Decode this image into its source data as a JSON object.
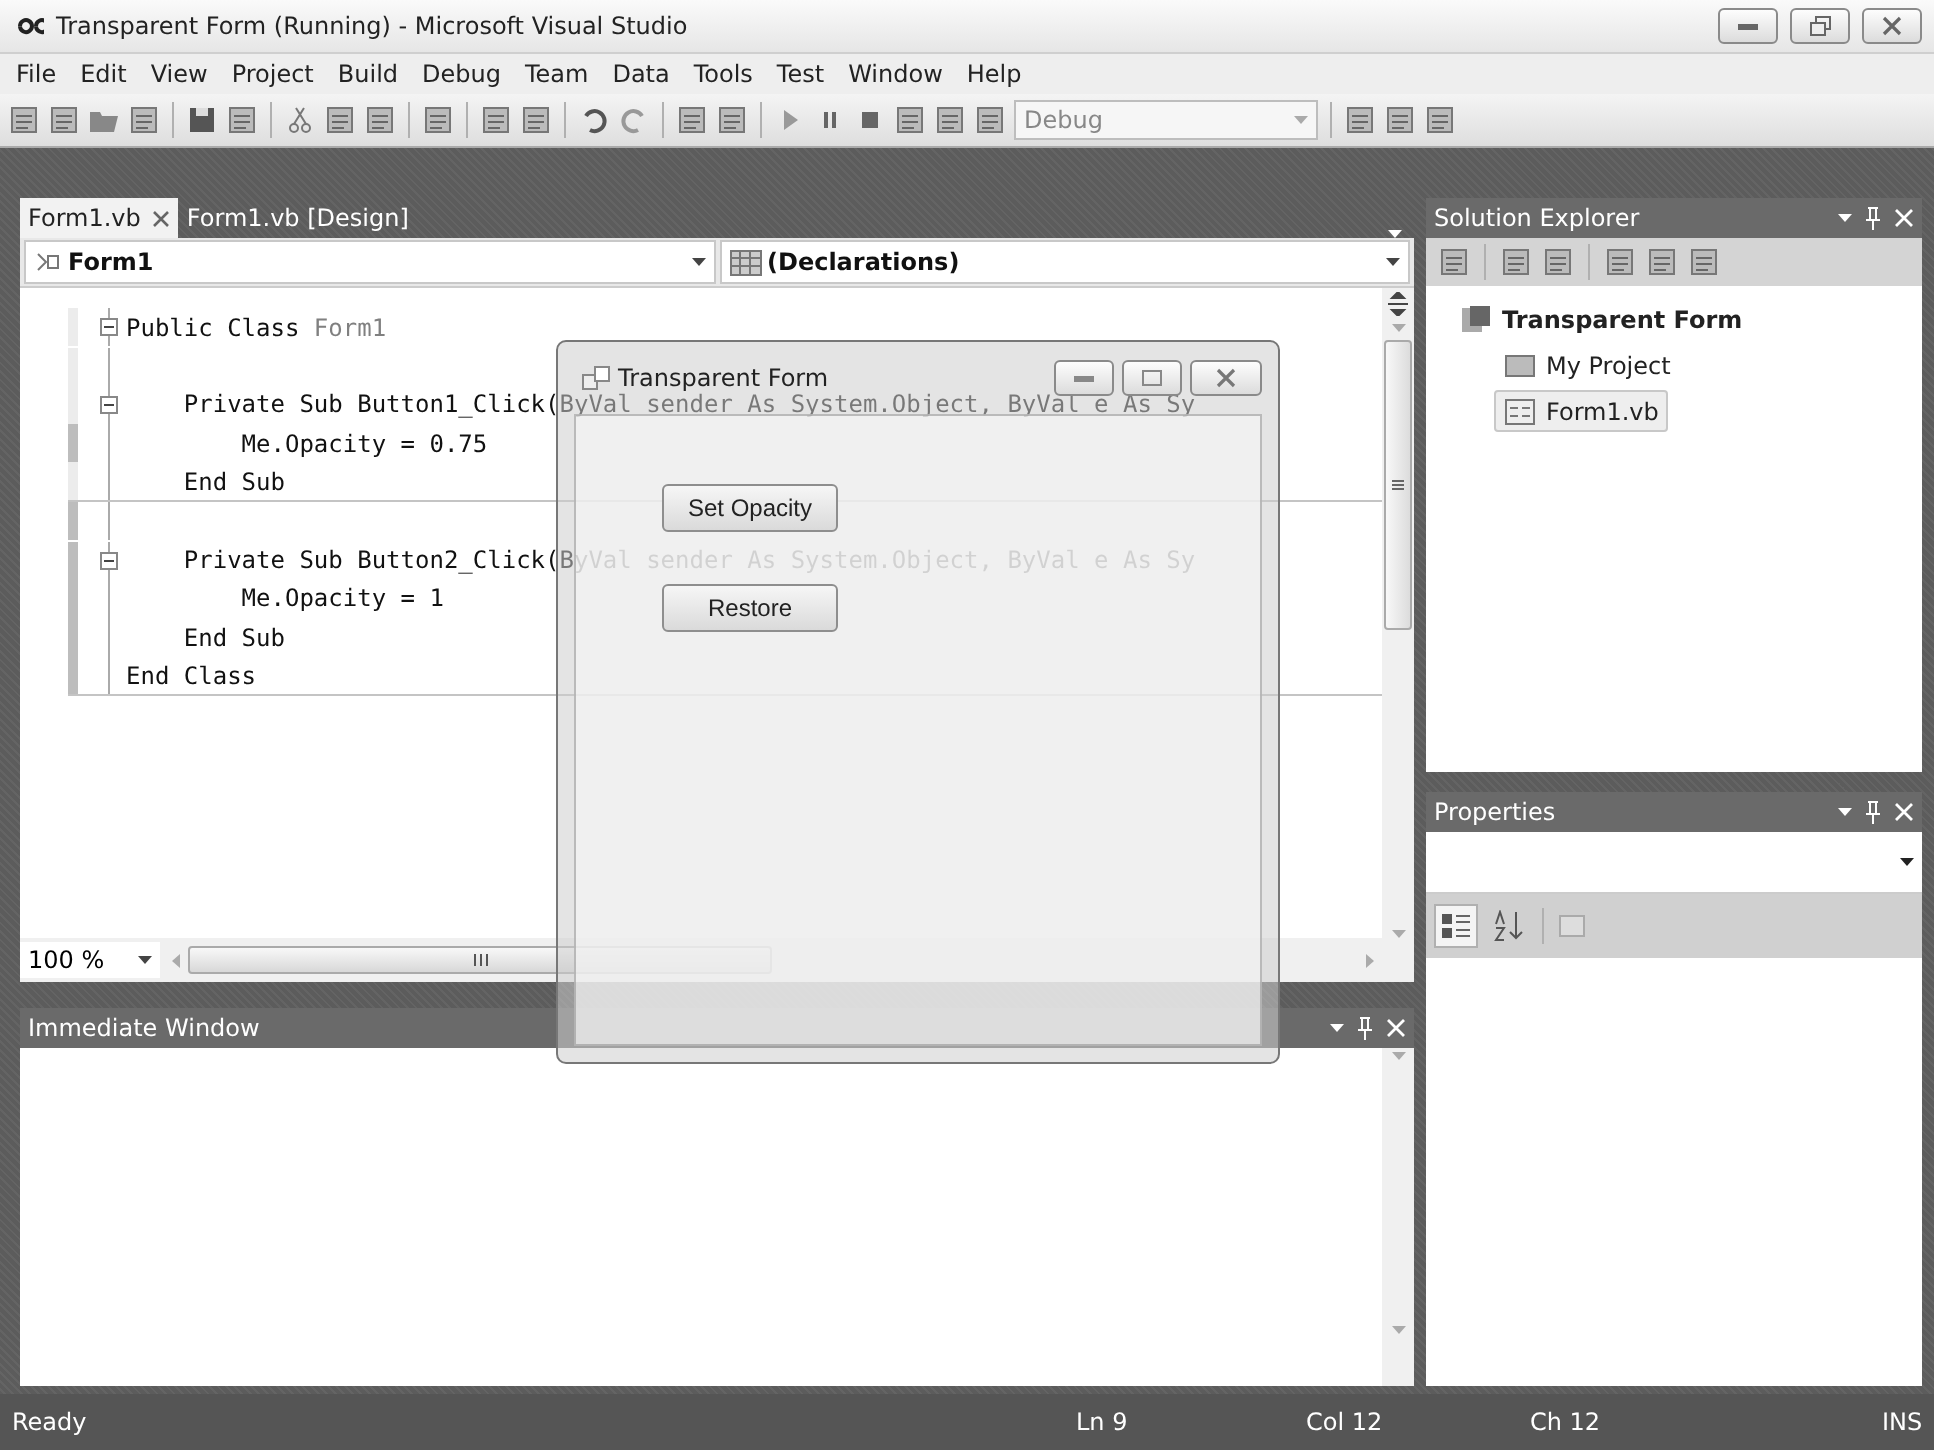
{
  "window": {
    "title": "Transparent Form (Running) - Microsoft Visual Studio"
  },
  "menu": [
    "File",
    "Edit",
    "View",
    "Project",
    "Build",
    "Debug",
    "Team",
    "Data",
    "Tools",
    "Test",
    "Window",
    "Help"
  ],
  "toolbar": {
    "configuration": "Debug"
  },
  "editor": {
    "tabs": [
      {
        "label": "Form1.vb",
        "selected": true
      },
      {
        "label": "Form1.vb [Design]",
        "selected": false
      }
    ],
    "class_dropdown": "Form1",
    "member_dropdown": "(Declarations)",
    "lines": [
      {
        "fold": true,
        "changed": false,
        "separator_below": false,
        "segments": [
          {
            "kind": "plain",
            "text": "Public Class "
          },
          {
            "kind": "type",
            "text": "Form1"
          }
        ]
      },
      {
        "fold": false,
        "changed": false,
        "separator_below": false
      },
      {
        "fold": true,
        "changed": false,
        "separator_below": false,
        "segments": [
          {
            "kind": "plain",
            "text": "    Private Sub Button1_Click(ByVal sender As System.Object, ByVal e As Sy"
          }
        ]
      },
      {
        "fold": false,
        "changed": true,
        "separator_below": false,
        "segments": [
          {
            "kind": "plain",
            "text": "        Me.Opacity = 0.75"
          }
        ]
      },
      {
        "fold": false,
        "changed": false,
        "separator_below": true,
        "segments": [
          {
            "kind": "plain",
            "text": "    End Sub"
          }
        ]
      },
      {
        "fold": false,
        "changed": true,
        "separator_below": false
      },
      {
        "fold": true,
        "changed": true,
        "separator_below": false,
        "segments": [
          {
            "kind": "plain",
            "text": "    Private Sub Button2_Click(ByVal sender As System.Object, ByVal e As Sy"
          }
        ]
      },
      {
        "fold": false,
        "changed": true,
        "separator_below": false,
        "segments": [
          {
            "kind": "plain",
            "text": "        Me.Opacity = 1"
          }
        ]
      },
      {
        "fold": false,
        "changed": true,
        "separator_below": false,
        "segments": [
          {
            "kind": "plain",
            "text": "    End Sub"
          }
        ]
      },
      {
        "fold": false,
        "changed": true,
        "separator_below": true,
        "segments": [
          {
            "kind": "plain",
            "text": "End Class"
          }
        ]
      }
    ],
    "zoom": "100 %"
  },
  "immediate_window": {
    "title": "Immediate Window"
  },
  "running_form": {
    "title": "Transparent Form",
    "buttons": [
      "Set Opacity",
      "Restore"
    ]
  },
  "solution_explorer": {
    "title": "Solution Explorer",
    "tree": [
      {
        "label": "Transparent Form",
        "kind": "project",
        "selected": false,
        "children": [
          {
            "label": "My Project",
            "kind": "folder",
            "selected": false
          },
          {
            "label": "Form1.vb",
            "kind": "form",
            "selected": true
          }
        ]
      }
    ]
  },
  "properties": {
    "title": "Properties",
    "view_buttons": [
      {
        "kind": "categorized",
        "selected": true
      },
      {
        "kind": "alphabetical",
        "selected": false
      }
    ]
  },
  "status_bar": {
    "message": "Ready",
    "line": "Ln 9",
    "column": "Col 12",
    "char": "Ch 12",
    "mode": "INS"
  }
}
